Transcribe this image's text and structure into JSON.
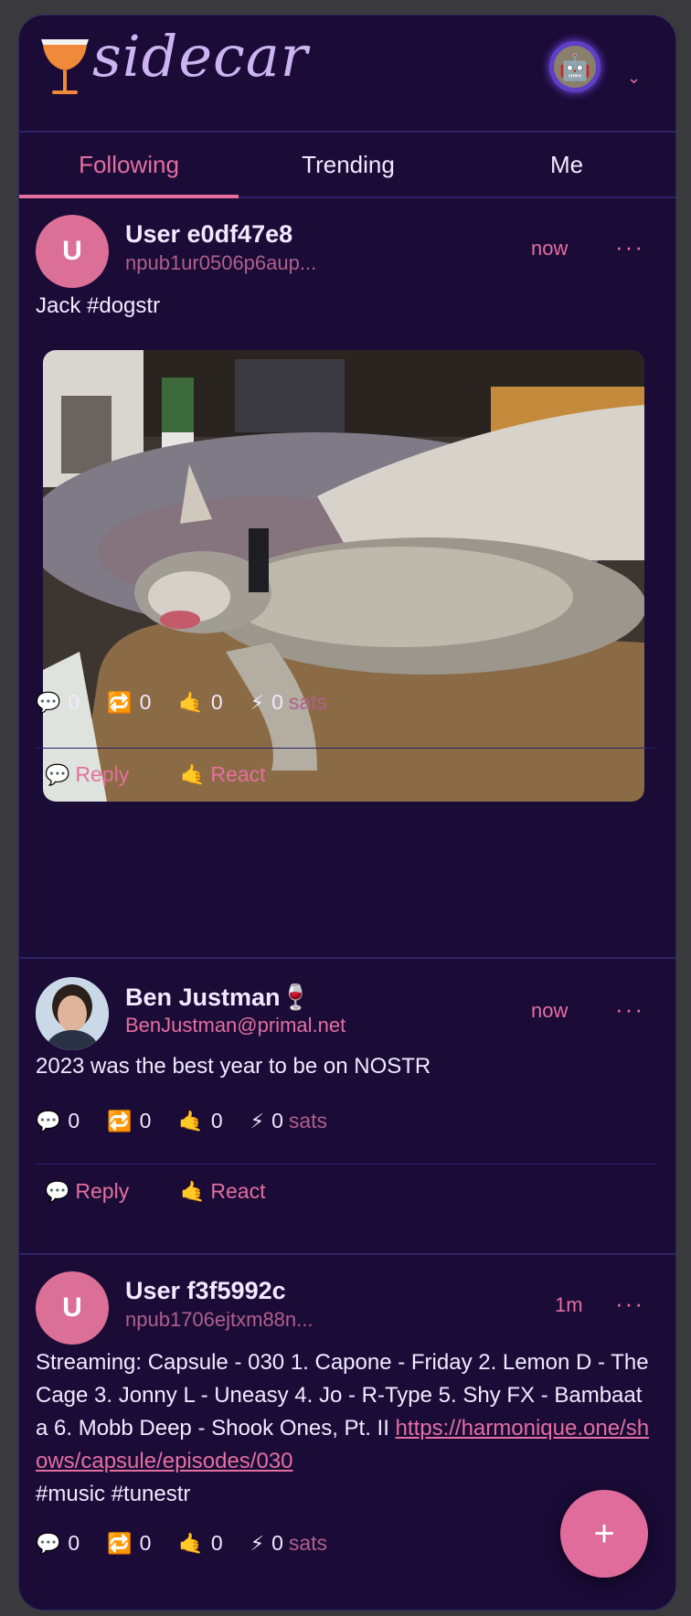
{
  "app": {
    "logo_text": "sidecar",
    "accent": "#e56fa0",
    "background": "#1a0b37"
  },
  "header": {
    "avatar_icon": "robot-avatar",
    "menu_icon": "chevron-down-icon"
  },
  "tabs": [
    {
      "label": "Following",
      "active": true
    },
    {
      "label": "Trending",
      "active": false
    },
    {
      "label": "Me",
      "active": false
    }
  ],
  "posts": [
    {
      "avatar_letter": "U",
      "name": "User e0df47e8",
      "sub": "npub1ur0506p6aup...",
      "time": "now",
      "text": "Jack #dogstr",
      "stats": {
        "replies": "0",
        "reposts": "0",
        "reactions": "0",
        "zaps": "0",
        "zap_unit": "sats"
      },
      "actions": {
        "reply": "Reply",
        "react": "React"
      }
    },
    {
      "name": "Ben Justman🍷",
      "sub": "BenJustman@primal.net",
      "time": "now",
      "text": "2023 was the best year to be on NOSTR",
      "stats": {
        "replies": "0",
        "reposts": "0",
        "reactions": "0",
        "zaps": "0",
        "zap_unit": "sats"
      },
      "actions": {
        "reply": "Reply",
        "react": "React"
      }
    },
    {
      "avatar_letter": "U",
      "name": "User f3f5992c",
      "sub": "npub1706ejtxm88n...",
      "time": "1m",
      "text_before": "Streaming: Capsule - 030 1. Capone - Friday 2. Lemon D - The Cage 3. Jonny L - Uneasy 4. Jo - R-Type 5. Shy FX - Bambaata 6. Mobb Deep - Shook Ones, Pt. II ",
      "link": "https://harmonique.one/shows/capsule/episodes/030",
      "text_after": "#music #tunestr",
      "stats": {
        "replies": "0",
        "reposts": "0",
        "reactions": "0",
        "zaps": "0",
        "zap_unit": "sats"
      }
    }
  ],
  "fab": {
    "label": "+"
  }
}
